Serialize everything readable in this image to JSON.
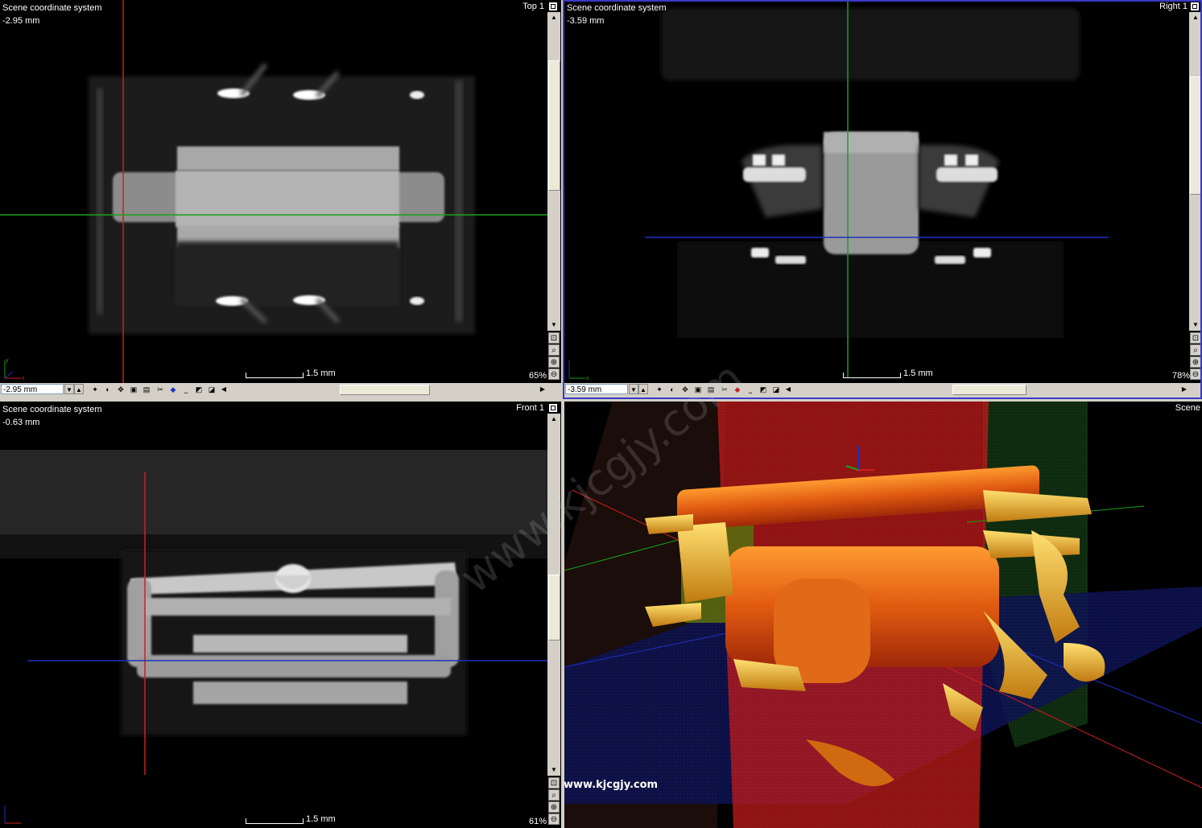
{
  "views": {
    "top": {
      "coord_label": "Scene coordinate system",
      "offset": "-2.95 mm",
      "name": "Top 1",
      "scale_label": "1.5 mm",
      "zoom": "65%",
      "position_field": "-2.95 mm"
    },
    "right": {
      "coord_label": "Scene coordinate system",
      "offset": "-3.59 mm",
      "name": "Right 1",
      "scale_label": "1.5 mm",
      "zoom": "78%",
      "position_field": "-3.59 mm"
    },
    "front": {
      "coord_label": "Scene coordinate system",
      "offset": "-0.63 mm",
      "name": "Front 1",
      "scale_label": "1.5 mm",
      "zoom": "61%"
    },
    "scene": {
      "name": "Scene"
    }
  },
  "axes": {
    "x": "x",
    "y": "y"
  },
  "watermark": {
    "text": "www.kjcgjy.com"
  },
  "colors": {
    "x_line": "#cc2020",
    "y_line": "#1aa01a",
    "z_line": "#2030c0",
    "model": "#e07010",
    "highlight": "#ffd040",
    "active_border": "#3a3ac8"
  },
  "toolbar_icons": [
    "light-icon",
    "contrast-icon",
    "move-icon",
    "window-icon",
    "cut-icon",
    "paint-icon",
    "measure-icon",
    "histogram-icon",
    "histogram-alt-icon"
  ]
}
